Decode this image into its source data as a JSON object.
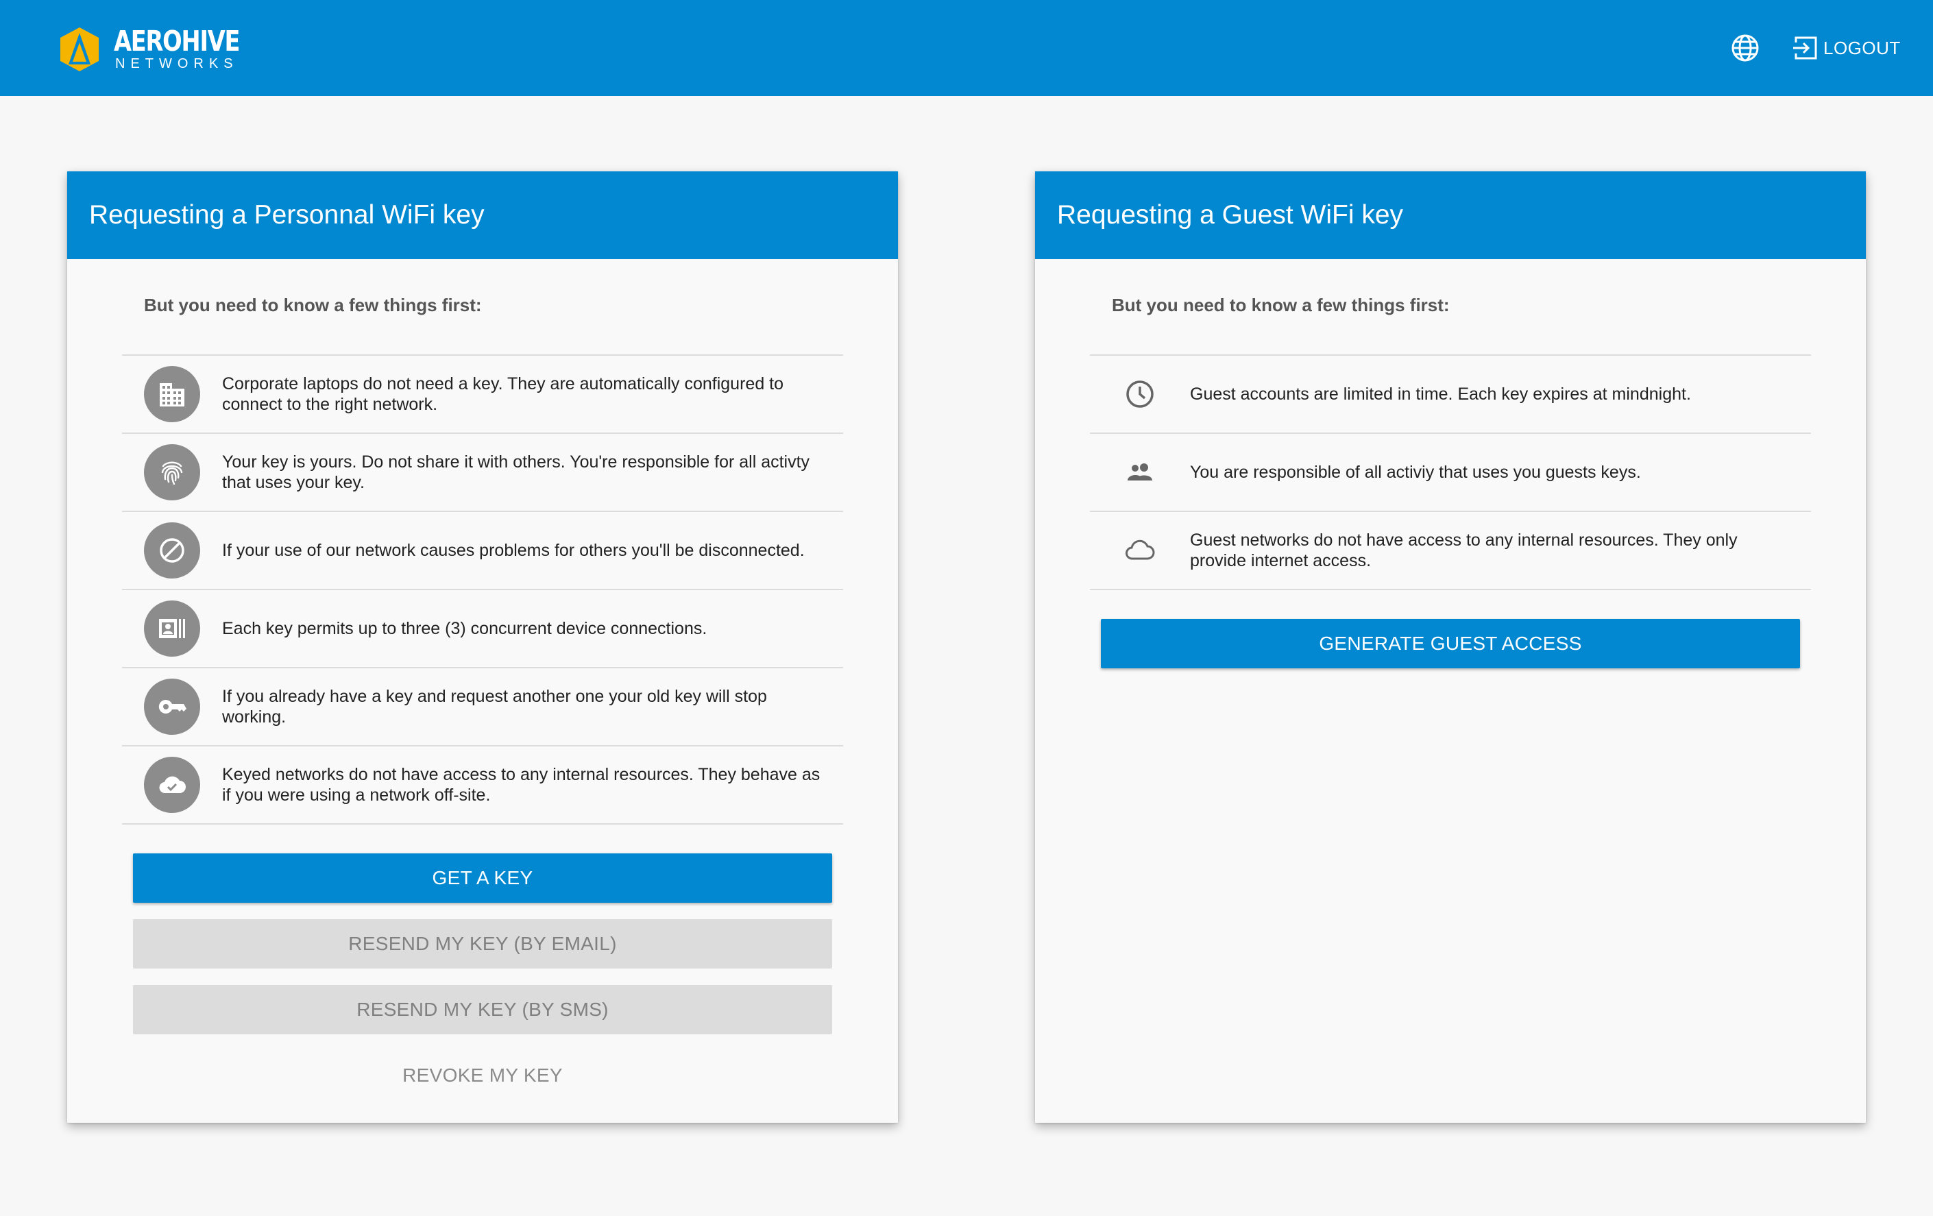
{
  "header": {
    "brand_name": "AEROHIVE",
    "brand_sub": "NETWORKS",
    "logout_label": "LOGOUT",
    "icons": {
      "language": "globe-icon",
      "logout": "logout-icon"
    },
    "colors": {
      "bar": "#0288d1",
      "logo_accent": "#f5b400"
    }
  },
  "personal": {
    "title": "Requesting a Personnal WiFi key",
    "intro": "But you need to know a few things first:",
    "items": [
      {
        "icon": "building-icon",
        "text": "Corporate laptops do not need a key. They are automatically configured to connect to the right network."
      },
      {
        "icon": "fingerprint-icon",
        "text": "Your key is yours. Do not share it with others. You're responsible for all activty that uses your key."
      },
      {
        "icon": "block-icon",
        "text": "If your use of our network causes problems for others you'll be disconnected."
      },
      {
        "icon": "devices-icon",
        "text": "Each key permits up to three (3) concurrent device connections."
      },
      {
        "icon": "key-icon",
        "text": "If you already have a key and request another one your old key will stop working."
      },
      {
        "icon": "cloud-check-icon",
        "text": "Keyed networks do not have access to any internal resources. They behave as if you were using a network off-site."
      }
    ],
    "get_key_label": "GET A KEY",
    "resend_email_label": "RESEND MY KEY (BY EMAIL)",
    "resend_sms_label": "RESEND MY KEY (BY SMS)",
    "revoke_label": "REVOKE MY KEY"
  },
  "guest": {
    "title": "Requesting a Guest WiFi key",
    "intro": "But you need to know a few things first:",
    "items": [
      {
        "icon": "clock-icon",
        "text": "Guest accounts are limited in time. Each key expires at mindnight."
      },
      {
        "icon": "people-icon",
        "text": "You are responsible of all activiy that uses you guests keys."
      },
      {
        "icon": "cloud-icon",
        "text": "Guest networks do not have access to any internal resources. They only provide internet access."
      }
    ],
    "generate_label": "GENERATE GUEST ACCESS"
  }
}
